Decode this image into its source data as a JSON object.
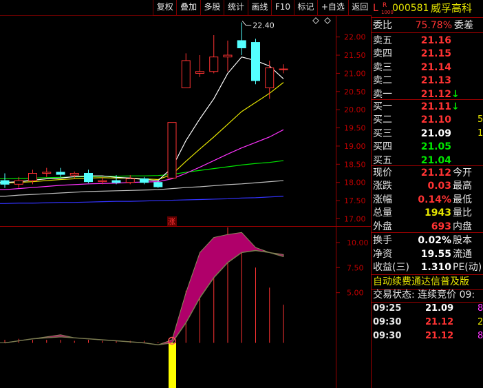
{
  "toolbar": [
    "复权",
    "叠加",
    "多股",
    "统计",
    "画线",
    "F10",
    "标记",
    "+自选",
    "返回"
  ],
  "header": {
    "prefix": "L",
    "badge_top": "R",
    "badge_bottom": "1000",
    "code": "000581",
    "name": "威孚高科"
  },
  "weibi": {
    "label": "委比",
    "value": "75.78%",
    "label2": "委差"
  },
  "asks": [
    {
      "label": "卖五",
      "price": "21.16"
    },
    {
      "label": "卖四",
      "price": "21.15"
    },
    {
      "label": "卖三",
      "price": "21.14"
    },
    {
      "label": "卖二",
      "price": "21.13"
    },
    {
      "label": "卖一",
      "price": "21.12",
      "arrow": "↓"
    }
  ],
  "bids": [
    {
      "label": "买一",
      "price": "21.11",
      "arrow": "↓"
    },
    {
      "label": "买二",
      "price": "21.10",
      "extra": "5"
    },
    {
      "label": "买三",
      "price": "21.09",
      "extra": "1"
    },
    {
      "label": "买四",
      "price": "21.05"
    },
    {
      "label": "买五",
      "price": "21.04"
    }
  ],
  "quote": [
    {
      "label": "现价",
      "value": "21.12",
      "label2": "今开"
    },
    {
      "label": "涨跌",
      "value": "0.03",
      "label2": "最高"
    },
    {
      "label": "涨幅",
      "value": "0.14%",
      "label2": "最低"
    },
    {
      "label": "总量",
      "value": "1943",
      "label2": "量比"
    },
    {
      "label": "外盘",
      "value": "693",
      "label2": "内盘"
    }
  ],
  "stats": [
    {
      "label": "换手",
      "value": "0.02%",
      "label2": "股本"
    },
    {
      "label": "净资",
      "value": "19.55",
      "label2": "流通"
    },
    {
      "label": "收益(三)",
      "value": "1.310",
      "label2": "PE(动)"
    }
  ],
  "banner": "自动续费通达信普及版",
  "trade_status": "交易状态: 连续竞价 09:",
  "ticks": [
    {
      "time": "09:25",
      "price": "21.09",
      "extra": "8"
    },
    {
      "time": "09:30",
      "price": "21.12",
      "extra": "2"
    },
    {
      "time": "09:30",
      "price": "21.12",
      "extra": "8"
    }
  ],
  "chart": {
    "high_label": "22.40",
    "price_axis": [
      "22.00",
      "21.50",
      "21.00",
      "20.50",
      "20.00",
      "19.50",
      "19.00",
      "18.50",
      "18.00",
      "17.50",
      "17.00"
    ],
    "ind_axis": [
      "10.00",
      "7.50",
      "5.00"
    ],
    "zhang_label": "涨",
    "colors": {
      "up": "#ff3333",
      "down": "#54ffff",
      "ma5": "#ffffff",
      "ma10": "#e6e600",
      "ma20": "#ff33ff",
      "ma30": "#00e600",
      "ma60": "#c0c0c0",
      "ma120": "#3333ff"
    }
  },
  "chart_data": {
    "type": "candlestick",
    "y_range": [
      16.8,
      22.6
    ],
    "candles": [
      {
        "o": 18.05,
        "h": 18.25,
        "l": 17.85,
        "c": 17.95
      },
      {
        "o": 17.95,
        "h": 18.15,
        "l": 17.85,
        "c": 18.05
      },
      {
        "o": 18.05,
        "h": 18.35,
        "l": 17.95,
        "c": 18.25
      },
      {
        "o": 18.25,
        "h": 18.4,
        "l": 18.15,
        "c": 18.28
      },
      {
        "o": 18.28,
        "h": 18.4,
        "l": 18.15,
        "c": 18.22
      },
      {
        "o": 18.2,
        "h": 18.3,
        "l": 18.1,
        "c": 18.25
      },
      {
        "o": 18.25,
        "h": 18.35,
        "l": 17.98,
        "c": 18.02
      },
      {
        "o": 18.02,
        "h": 18.15,
        "l": 17.95,
        "c": 18.05
      },
      {
        "o": 18.05,
        "h": 18.2,
        "l": 17.95,
        "c": 18.0
      },
      {
        "o": 18.0,
        "h": 18.2,
        "l": 17.95,
        "c": 18.1
      },
      {
        "o": 18.1,
        "h": 18.15,
        "l": 17.95,
        "c": 18.0
      },
      {
        "o": 18.0,
        "h": 18.05,
        "l": 17.85,
        "c": 17.88
      },
      {
        "o": 18.12,
        "h": 19.65,
        "l": 18.12,
        "c": 19.65
      },
      {
        "o": 20.6,
        "h": 21.55,
        "l": 20.6,
        "c": 21.35
      },
      {
        "o": 21.0,
        "h": 21.5,
        "l": 20.9,
        "c": 21.05
      },
      {
        "o": 21.05,
        "h": 22.05,
        "l": 21.0,
        "c": 21.45
      },
      {
        "o": 21.45,
        "h": 21.9,
        "l": 21.05,
        "c": 21.5
      },
      {
        "o": 21.9,
        "h": 22.4,
        "l": 21.5,
        "c": 21.7
      },
      {
        "o": 21.85,
        "h": 21.95,
        "l": 20.7,
        "c": 20.8
      },
      {
        "o": 20.6,
        "h": 21.35,
        "l": 20.3,
        "c": 21.15
      },
      {
        "o": 21.1,
        "h": 21.25,
        "l": 21.0,
        "c": 21.12
      }
    ],
    "ma5": [
      18.0,
      18.02,
      18.06,
      18.1,
      18.12,
      18.16,
      18.18,
      18.18,
      18.14,
      18.12,
      18.08,
      18.05,
      18.4,
      19.15,
      19.75,
      20.3,
      21.0,
      21.45,
      21.35,
      21.2,
      20.85
    ],
    "ma10": [
      17.98,
      18.0,
      18.02,
      18.05,
      18.08,
      18.1,
      18.12,
      18.13,
      18.12,
      18.12,
      18.1,
      18.08,
      18.22,
      18.58,
      18.92,
      19.25,
      19.6,
      19.95,
      20.2,
      20.45,
      20.75
    ],
    "ma20": [
      17.8,
      17.83,
      17.86,
      17.89,
      17.92,
      17.94,
      17.96,
      17.97,
      17.98,
      18.0,
      18.01,
      18.02,
      18.1,
      18.25,
      18.42,
      18.6,
      18.78,
      18.95,
      19.1,
      19.25,
      19.45
    ],
    "ma30": [
      18.1,
      18.11,
      18.12,
      18.13,
      18.14,
      18.15,
      18.16,
      18.17,
      18.17,
      18.18,
      18.18,
      18.19,
      18.22,
      18.28,
      18.33,
      18.38,
      18.43,
      18.48,
      18.52,
      18.55,
      18.6
    ],
    "ma60": [
      17.62,
      17.65,
      17.67,
      17.69,
      17.71,
      17.73,
      17.75,
      17.76,
      17.77,
      17.78,
      17.79,
      17.8,
      17.83,
      17.86,
      17.88,
      17.91,
      17.94,
      17.96,
      17.99,
      18.02,
      18.05
    ],
    "ma120": [
      17.42,
      17.43,
      17.43,
      17.44,
      17.45,
      17.45,
      17.46,
      17.47,
      17.48,
      17.48,
      17.49,
      17.5,
      17.51,
      17.52,
      17.53,
      17.54,
      17.55,
      17.57,
      17.58,
      17.6,
      17.62
    ],
    "ind_range": [
      -4.5,
      11.5
    ],
    "ind_upper": [
      0.0,
      0.2,
      0.4,
      0.6,
      0.8,
      0.5,
      0.4,
      0.3,
      0.2,
      0.1,
      0.0,
      -0.2,
      0.3,
      5.0,
      9.0,
      10.5,
      10.8,
      11.0,
      9.5,
      9.0,
      8.8
    ],
    "ind_lower": [
      0.0,
      0.2,
      0.4,
      0.5,
      0.6,
      0.5,
      0.4,
      0.3,
      0.2,
      0.1,
      0.0,
      -0.2,
      0.0,
      2.0,
      4.5,
      6.5,
      8.0,
      9.0,
      9.2,
      9.0,
      8.6
    ],
    "ind_bars": [
      0.3,
      0.4,
      0.3,
      0.3,
      0.3,
      0.2,
      0.3,
      0.2,
      0.2,
      0.2,
      0.2,
      0.1,
      0,
      5.2,
      8.5,
      10.0,
      11.5,
      9.5,
      7.5,
      5.5,
      3.8
    ],
    "ind_signal": -4.5
  }
}
